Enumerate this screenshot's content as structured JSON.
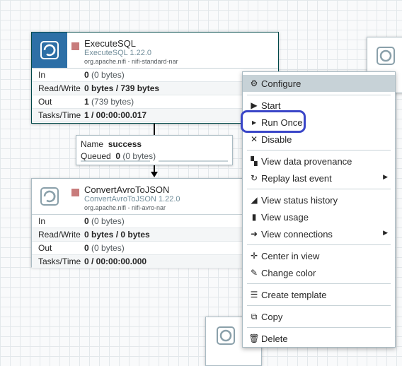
{
  "processors": [
    {
      "name": "ExecuteSQL",
      "type": "ExecuteSQL 1.22.0",
      "bundle": "org.apache.nifi - nifi-standard-nar",
      "stats": [
        {
          "label": "In",
          "value": "0",
          "sub": "(0 bytes)"
        },
        {
          "label": "Read/Write",
          "value": "0 bytes / 739 bytes",
          "sub": ""
        },
        {
          "label": "Out",
          "value": "1",
          "sub": "(739 bytes)"
        },
        {
          "label": "Tasks/Time",
          "value": "1 / 00:00:00.017",
          "sub": ""
        }
      ]
    },
    {
      "name": "ConvertAvroToJSON",
      "type": "ConvertAvroToJSON 1.22.0",
      "bundle": "org.apache.nifi - nifi-avro-nar",
      "stats": [
        {
          "label": "In",
          "value": "0",
          "sub": "(0 bytes)"
        },
        {
          "label": "Read/Write",
          "value": "0 bytes / 0 bytes",
          "sub": ""
        },
        {
          "label": "Out",
          "value": "0",
          "sub": "(0 bytes)"
        },
        {
          "label": "Tasks/Time",
          "value": "0 / 00:00:00.000",
          "sub": ""
        }
      ]
    }
  ],
  "connection": {
    "name_label": "Name",
    "name_value": "success",
    "queued_label": "Queued",
    "queued_value": "0",
    "queued_sub": "(0 bytes)"
  },
  "context_menu": {
    "items": [
      {
        "label": "Configure",
        "icon": "gear-icon",
        "glyph": "⚙"
      },
      {
        "label": "Start",
        "icon": "play-icon",
        "glyph": "▶"
      },
      {
        "label": "Run Once",
        "icon": "caret-right-icon",
        "glyph": "▸"
      },
      {
        "label": "Disable",
        "icon": "disable-icon",
        "glyph": "✕"
      },
      {
        "label": "View data provenance",
        "icon": "provenance-icon",
        "glyph": "▚"
      },
      {
        "label": "Replay last event",
        "icon": "replay-icon",
        "glyph": "↻"
      },
      {
        "label": "View status history",
        "icon": "chart-icon",
        "glyph": "◢"
      },
      {
        "label": "View usage",
        "icon": "book-icon",
        "glyph": "▮"
      },
      {
        "label": "View connections",
        "icon": "connections-icon",
        "glyph": "➜"
      },
      {
        "label": "Center in view",
        "icon": "crosshair-icon",
        "glyph": "✛"
      },
      {
        "label": "Change color",
        "icon": "brush-icon",
        "glyph": "✎"
      },
      {
        "label": "Create template",
        "icon": "template-icon",
        "glyph": "☰"
      },
      {
        "label": "Copy",
        "icon": "copy-icon",
        "glyph": "⧉"
      },
      {
        "label": "Delete",
        "icon": "trash-icon",
        "glyph": "🗑"
      }
    ]
  },
  "colors": {
    "canvas": "#f9fafb",
    "grid": "#e3e8eb",
    "selected_icon_bg": "#2d6fa6",
    "stopped": "#c87c7c",
    "menu_highlight": "#c7d2d7",
    "annotation_circle": "#3a46c8"
  }
}
